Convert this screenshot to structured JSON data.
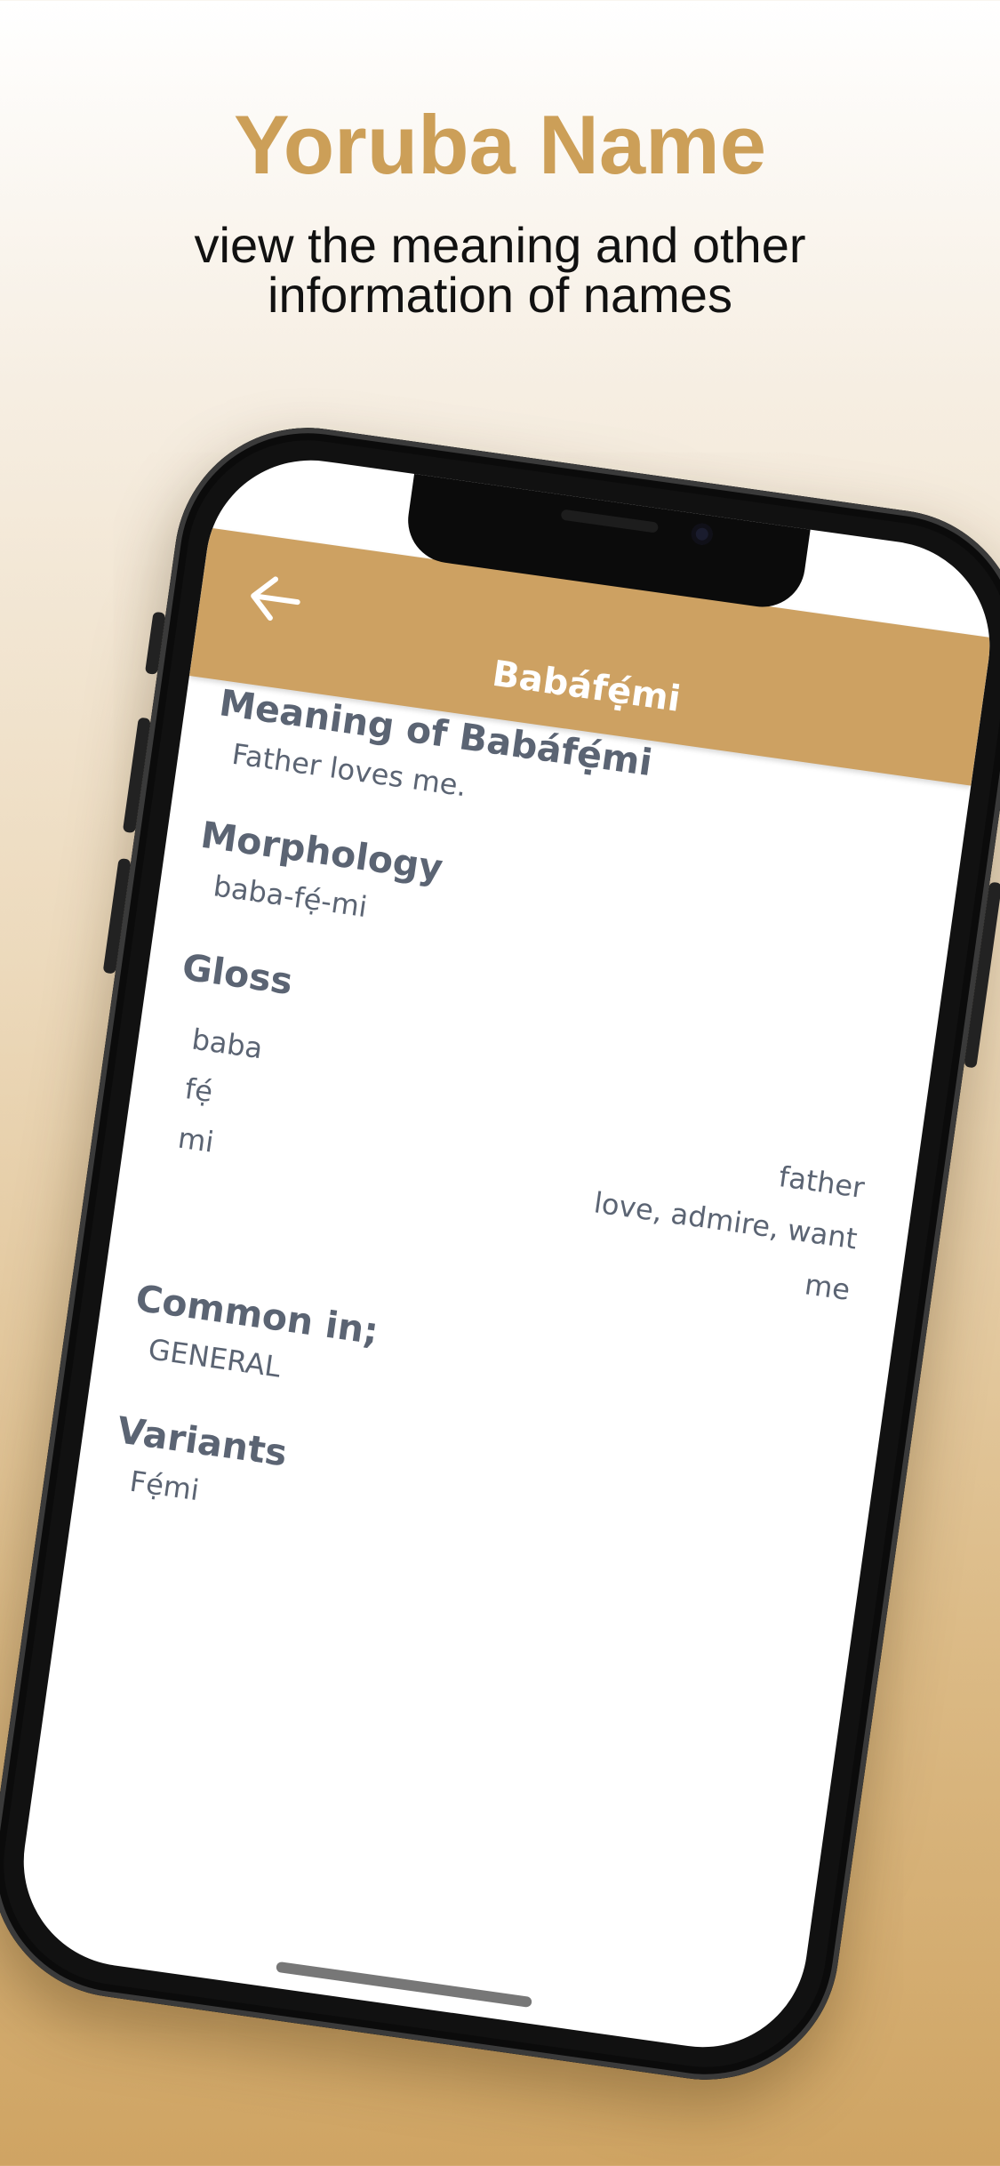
{
  "promo": {
    "title": "Yoruba Name",
    "subtitle": "view the meaning and other\ninformation of names"
  },
  "nav": {
    "title": "Babáfẹ́mi",
    "back_icon": "arrow-left-icon"
  },
  "details": {
    "meaning_heading": "Meaning of Babáfẹ́mi",
    "meaning_value": "Father loves me.",
    "morphology_heading": "Morphology",
    "morphology_value": "baba-fẹ́-mi",
    "gloss_heading": "Gloss",
    "gloss": [
      {
        "word": "baba",
        "meaning": "father"
      },
      {
        "word": "fẹ́",
        "meaning": "love, admire, want"
      },
      {
        "word": "mi",
        "meaning": "me"
      }
    ],
    "common_heading": "Common in;",
    "common_value": "GENERAL",
    "variants_heading": "Variants",
    "variants_value": "Fẹ́mi"
  },
  "colors": {
    "accent": "#cda162",
    "title": "#cc9f58",
    "text": "#5b6473"
  }
}
